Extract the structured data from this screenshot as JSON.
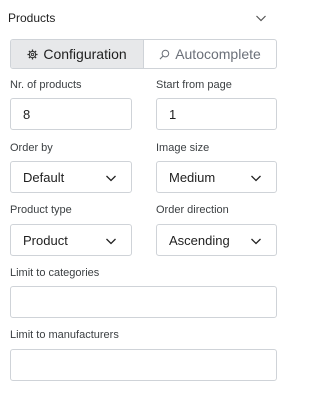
{
  "panel": {
    "title": "Products"
  },
  "tabs": [
    {
      "label": "Configuration",
      "icon": "gear-icon",
      "active": true
    },
    {
      "label": "Autocomplete",
      "icon": "search-icon",
      "active": false
    }
  ],
  "fields": {
    "nr_products": {
      "label": "Nr. of products",
      "value": "8"
    },
    "start_page": {
      "label": "Start from page",
      "value": "1"
    },
    "order_by": {
      "label": "Order by",
      "value": "Default"
    },
    "image_size": {
      "label": "Image size",
      "value": "Medium"
    },
    "product_type": {
      "label": "Product type",
      "value": "Product"
    },
    "order_direction": {
      "label": "Order direction",
      "value": "Ascending"
    },
    "limit_categories": {
      "label": "Limit to categories",
      "value": ""
    },
    "limit_manufacturers": {
      "label": "Limit to manufacturers",
      "value": ""
    }
  },
  "colors": {
    "border": "#cfd3d8",
    "active_tab_bg": "#e7e8ea"
  }
}
